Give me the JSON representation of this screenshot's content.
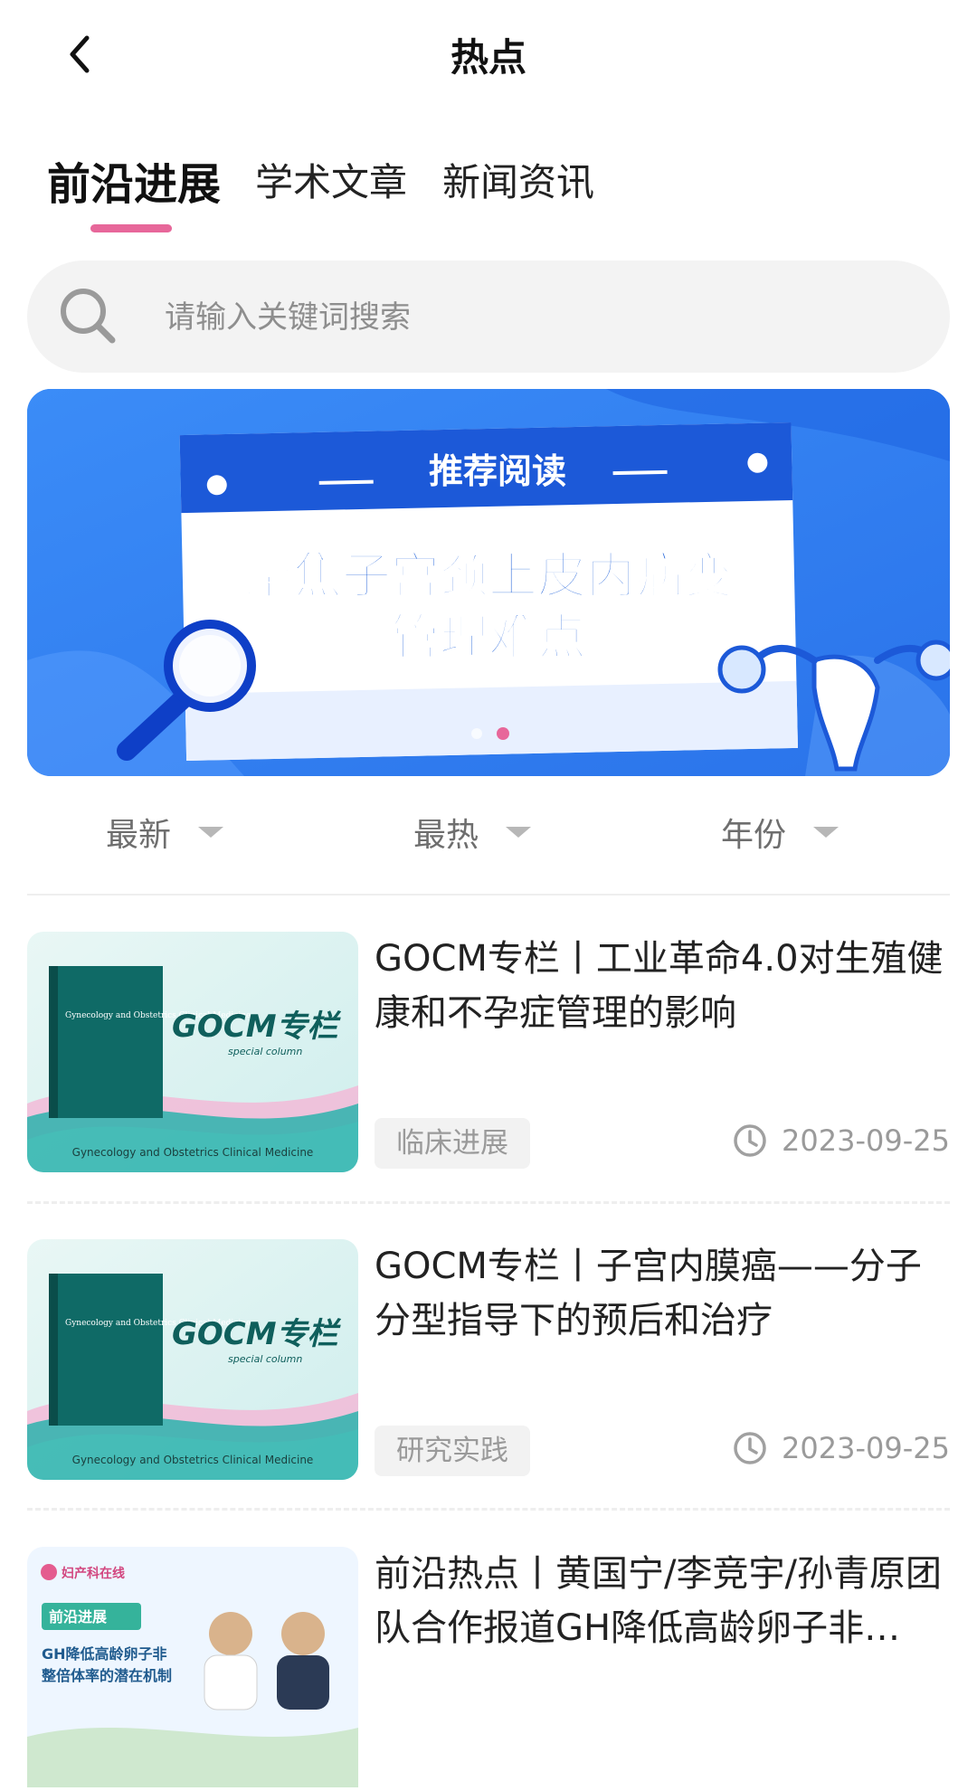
{
  "header": {
    "title": "热点"
  },
  "tabs": [
    {
      "label": "前沿进展",
      "active": true
    },
    {
      "label": "学术文章",
      "active": false
    },
    {
      "label": "新闻资讯",
      "active": false
    }
  ],
  "search": {
    "placeholder": "请输入关键词搜索"
  },
  "banner": {
    "header_text": "推荐阅读",
    "title_line1": "聚焦子宫颈上皮内病变",
    "title_line2": "管理难点",
    "page_index": 2,
    "page_count": 2
  },
  "filters": [
    {
      "label": "最新",
      "icon": "caret-down-icon"
    },
    {
      "label": "最热",
      "icon": "caret-down-icon"
    },
    {
      "label": "年份",
      "icon": "caret-down-icon"
    }
  ],
  "articles": [
    {
      "title": "GOCM专栏丨工业革命4.0对生殖健康和不孕症管理的影响",
      "tag": "临床进展",
      "date": "2023-09-25",
      "thumb": {
        "book_title": "Gynecology and Obstetrics Clinical Medicine",
        "brand": "GOCM专栏",
        "sub": "special column",
        "caption": "Gynecology and Obstetrics Clinical Medicine"
      }
    },
    {
      "title": "GOCM专栏丨子宫内膜癌——分子分型指导下的预后和治疗",
      "tag": "研究实践",
      "date": "2023-09-25",
      "thumb": {
        "book_title": "Gynecology and Obstetrics Clinical Medicine",
        "brand": "GOCM专栏",
        "sub": "special column",
        "caption": "Gynecology and Obstetrics Clinical Medicine"
      }
    },
    {
      "title": "前沿热点丨黄国宁/李竞宇/孙青原团队合作报道GH降低高龄卵子非…",
      "tag": "",
      "date": "",
      "thumb": {
        "logo": "妇产科在线",
        "badge": "前沿进展",
        "line1": "GH降低高龄卵子非",
        "line2": "整倍体率的潜在机制"
      }
    }
  ],
  "colors": {
    "accent_pink": "#e7679a",
    "banner_blue": "#2f7ef1",
    "gocm_teal": "#1f8f8a"
  }
}
